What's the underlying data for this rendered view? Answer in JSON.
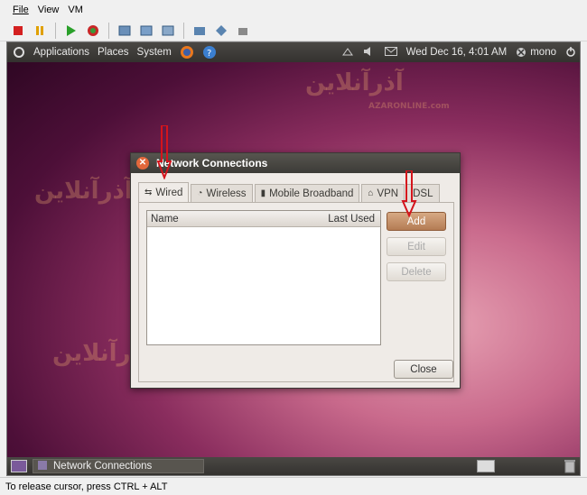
{
  "host": {
    "menu": [
      "File",
      "View",
      "VM"
    ],
    "toolbar_icons": [
      "stop-icon",
      "pause-icon",
      "play-icon",
      "reset-icon",
      "snapshot-icon",
      "snapshot-restore-icon",
      "snapshot-manager-icon",
      "fullscreen-icon",
      "unity-icon",
      "settings-icon"
    ],
    "status_text": "To release cursor, press CTRL + ALT"
  },
  "gnome": {
    "applications": "Applications",
    "places": "Places",
    "system": "System",
    "datetime": "Wed Dec 16,  4:01 AM",
    "user": "mono"
  },
  "taskbar": {
    "task_label": "Network Connections"
  },
  "watermark": {
    "brand_fa": "آذرآنلاین",
    "brand_en": "AZARONLINE.com"
  },
  "dialog": {
    "title": "Network Connections",
    "tabs": [
      "Wired",
      "Wireless",
      "Mobile Broadband",
      "VPN",
      "DSL"
    ],
    "columns": [
      "Name",
      "Last Used"
    ],
    "buttons": {
      "add": "Add",
      "edit": "Edit",
      "delete": "Delete",
      "close": "Close"
    }
  },
  "colors": {
    "accent_arrow": "#d4141c",
    "title_bar": "#3c3b37"
  }
}
